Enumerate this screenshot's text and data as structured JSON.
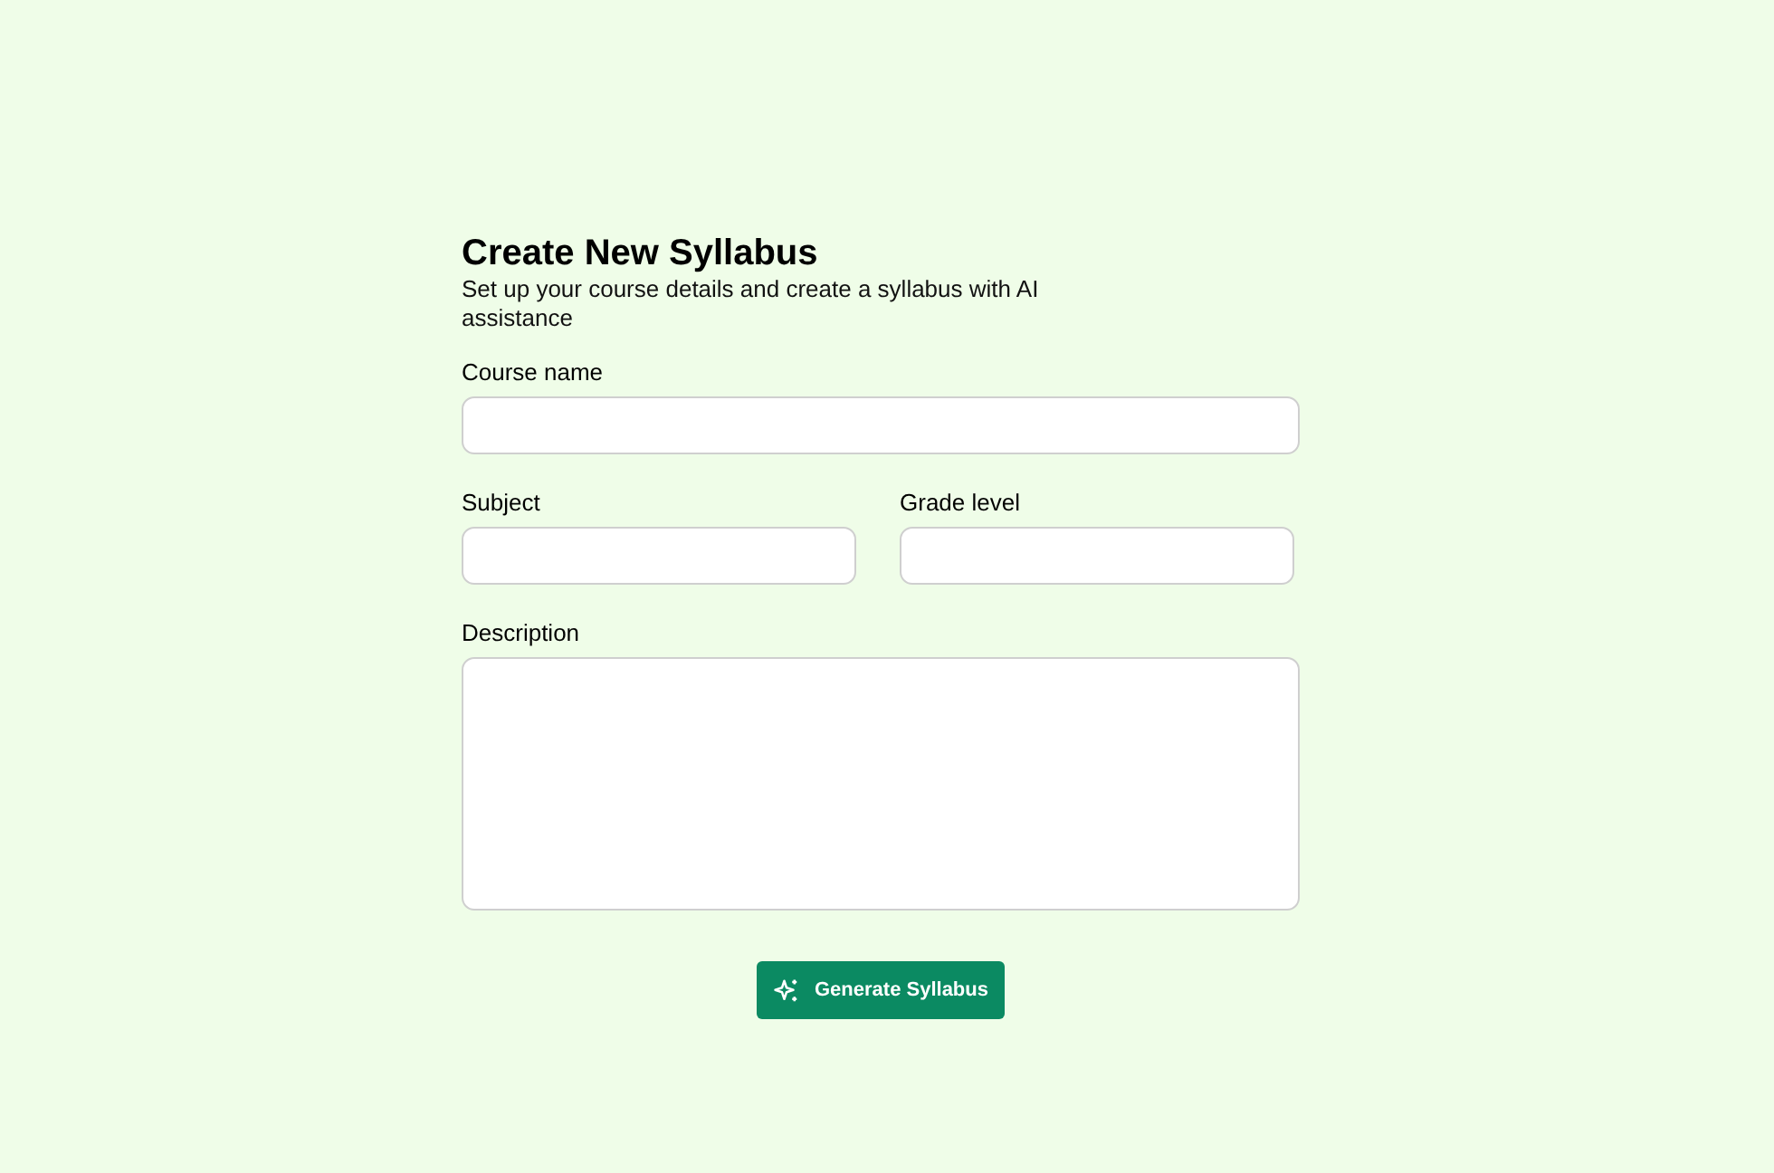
{
  "title": "Create New Syllabus",
  "subtitle": "Set up your course details and create a syllabus with AI assistance",
  "fields": [
    {
      "label": "Course name",
      "kind": "input"
    },
    {
      "label": "Subject",
      "kind": "input"
    },
    {
      "label": "Grade level",
      "kind": "input"
    },
    {
      "label": "Description",
      "kind": "textarea"
    }
  ],
  "button": "Generate Syllabus"
}
